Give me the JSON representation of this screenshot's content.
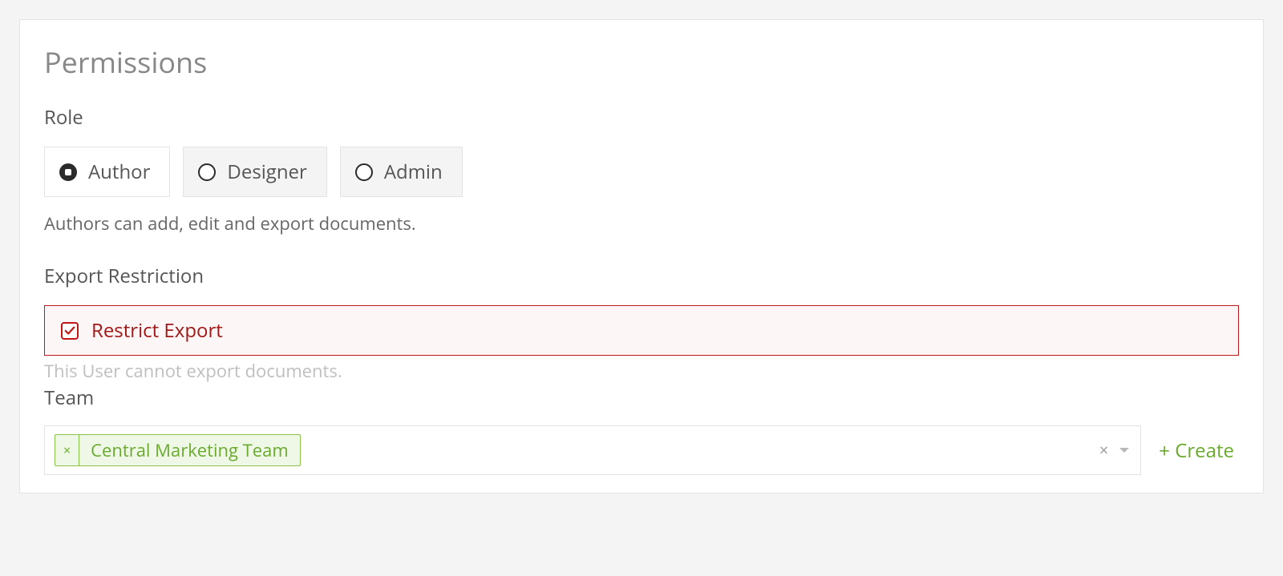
{
  "title": "Permissions",
  "role": {
    "label": "Role",
    "options": [
      "Author",
      "Designer",
      "Admin"
    ],
    "selected_index": 0,
    "hint": "Authors can add, edit and export documents."
  },
  "export_restriction": {
    "label": "Export Restriction",
    "checkbox_label": "Restrict Export",
    "checked": true,
    "hint": "This User cannot export documents."
  },
  "team": {
    "label": "Team",
    "chips": [
      "Central Marketing Team"
    ],
    "create_label": "+ Create"
  },
  "colors": {
    "danger": "#c01818",
    "success": "#6aab2e"
  }
}
